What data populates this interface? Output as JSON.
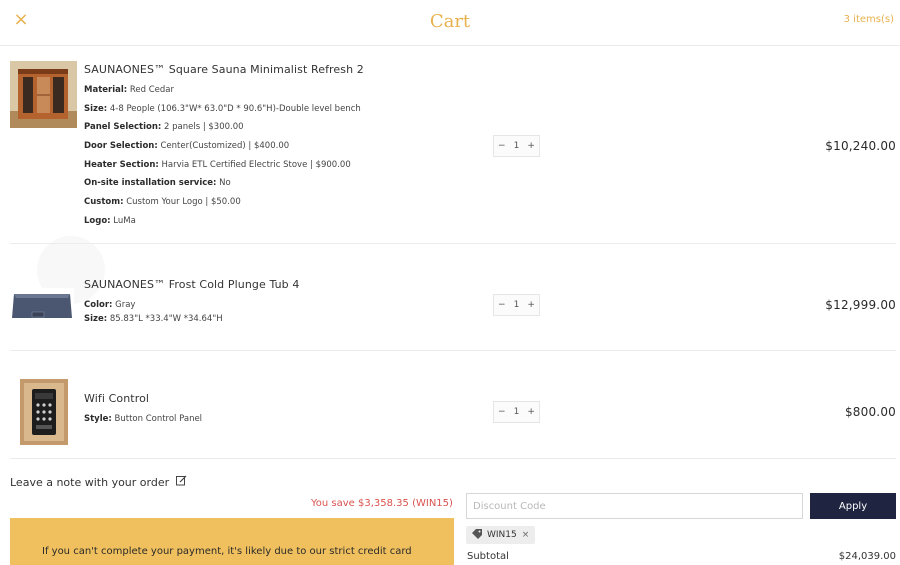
{
  "header": {
    "close_icon": "×",
    "title": "Cart",
    "item_count": "3 items(s)"
  },
  "items": [
    {
      "name": "SAUNAONES™ Square Sauna Minimalist Refresh 2",
      "options": [
        {
          "key": "Material:",
          "value": "Red Cedar"
        },
        {
          "key": "Size:",
          "value": "4-8 People (106.3\"W* 63.0\"D * 90.6\"H)-Double level bench"
        },
        {
          "key": "Panel Selection:",
          "value": "2 panels | $300.00"
        },
        {
          "key": "Door Selection:",
          "value": "Center(Customized) | $400.00"
        },
        {
          "key": "Heater Section:",
          "value": "Harvia ETL Certified Electric Stove | $900.00"
        },
        {
          "key": "On-site installation service:",
          "value": "No"
        },
        {
          "key": "Custom:",
          "value": "Custom Your Logo | $50.00"
        },
        {
          "key": "Logo:",
          "value": "LuMa"
        }
      ],
      "qty": {
        "minus": "−",
        "value": "1",
        "plus": "+"
      },
      "price": "$10,240.00"
    },
    {
      "name": "SAUNAONES™ Frost Cold Plunge Tub 4",
      "options": [
        {
          "key": "Color:",
          "value": "Gray"
        },
        {
          "key": "Size:",
          "value": "85.83\"L *33.4\"W *34.64\"H"
        }
      ],
      "qty": {
        "minus": "−",
        "value": "1",
        "plus": "+"
      },
      "price": "$12,999.00"
    },
    {
      "name": "Wifi Control",
      "options": [
        {
          "key": "Style:",
          "value": "Button Control Panel"
        }
      ],
      "qty": {
        "minus": "−",
        "value": "1",
        "plus": "+"
      },
      "price": "$800.00"
    }
  ],
  "note": {
    "label": "Leave a note with your order",
    "icon": "edit-icon"
  },
  "savings": "You save $3,358.35 (WIN15)",
  "discount": {
    "placeholder": "Discount Code",
    "value": "",
    "apply_label": "Apply"
  },
  "applied_code": {
    "code": "WIN15",
    "remove": "×",
    "icon": "tag-icon"
  },
  "subtotal": {
    "label": "Subtotal",
    "value": "$24,039.00"
  },
  "banner": {
    "text": "If you can't complete your payment, it's likely due to our strict credit card"
  },
  "colors": {
    "accent": "#e8b14e",
    "button": "#1f2440",
    "savings": "#d9534f",
    "banner": "#f0c05e"
  }
}
